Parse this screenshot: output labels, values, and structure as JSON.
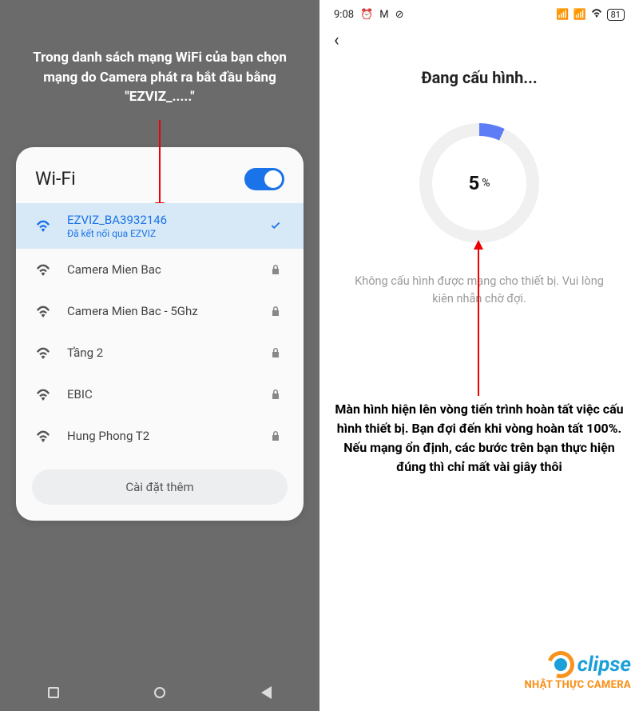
{
  "left": {
    "instruction": "Trong danh sách mạng WiFi của bạn chọn mạng do Camera phát ra bắt đầu bằng \"EZVIZ_.....\"",
    "wifi_title": "Wi-Fi",
    "networks": [
      {
        "name": "EZVIZ_BA3932146",
        "sub": "Đã kết nối qua EZVIZ",
        "selected": true,
        "locked": false
      },
      {
        "name": "Camera Mien Bac",
        "sub": "",
        "selected": false,
        "locked": true
      },
      {
        "name": "Camera Mien Bac - 5Ghz",
        "sub": "",
        "selected": false,
        "locked": true
      },
      {
        "name": "Tầng 2",
        "sub": "",
        "selected": false,
        "locked": true
      },
      {
        "name": "EBIC",
        "sub": "",
        "selected": false,
        "locked": true
      },
      {
        "name": "Hung Phong T2",
        "sub": "",
        "selected": false,
        "locked": true
      }
    ],
    "more_label": "Cài đặt thêm"
  },
  "right": {
    "status": {
      "time": "9:08",
      "battery": "81"
    },
    "title": "Đang cấu hình...",
    "progress_value": "5",
    "progress_unit": "%",
    "message": "Không cấu hình được mạng cho thiết bị. Vui lòng kiên nhẫn chờ đợi.",
    "instruction": "Màn hình hiện lên vòng tiến trình hoàn tất việc cấu hình thiết bị. Bạn đợi đến khi vòng hoàn tất 100%. Nếu mạng ổn định, các bước trên bạn thực hiện đúng thì chỉ mất vài giây thôi"
  },
  "logo": {
    "brand": "clipse",
    "sub": "NHẬT THỰC CAMERA"
  }
}
